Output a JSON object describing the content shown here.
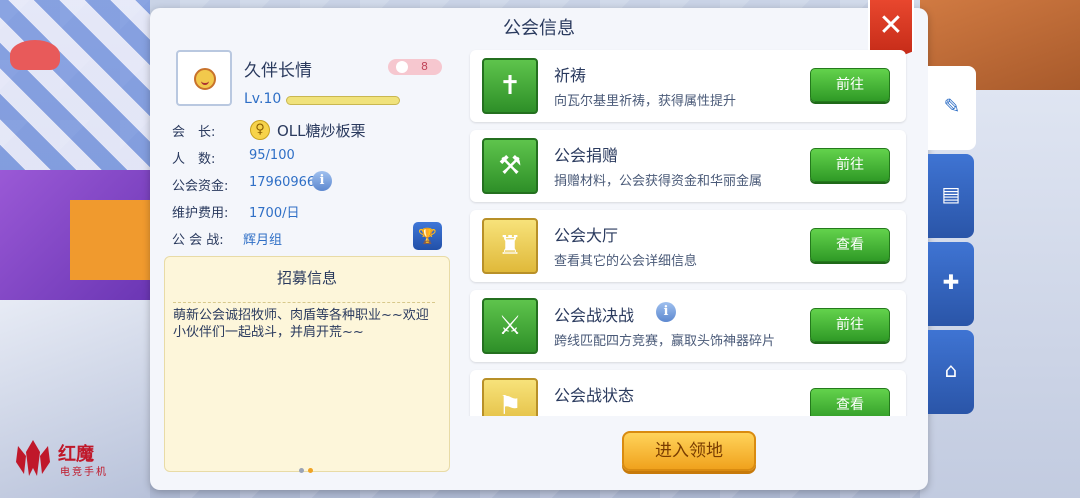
{
  "header": {
    "title": "公会信息",
    "close_icon": "✕"
  },
  "guild": {
    "name": "久伴长情",
    "rank": "8",
    "level": "Lv.10",
    "level_progress": 1.0,
    "rows": [
      {
        "label": "会　长:",
        "value": "OLL糖炒板栗"
      },
      {
        "label": "人　数:",
        "value": "95/100"
      },
      {
        "label": "公会资金:",
        "value": "17960966"
      },
      {
        "label": "维护费用:",
        "value": "1700/日"
      },
      {
        "label": "公 会 战:",
        "value": "辉月组"
      }
    ]
  },
  "recruit": {
    "title": "招募信息",
    "text": "萌新公会诚招牧师、肉盾等各种职业~~欢迎小伙伴们一起战斗，并肩开荒~~"
  },
  "cards": [
    {
      "title": "祈祷",
      "desc": "向瓦尔基里祈祷，获得属性提升",
      "button": "前往",
      "icon": "prayer-icon"
    },
    {
      "title": "公会捐赠",
      "desc": "捐赠材料，公会获得资金和华丽金属",
      "button": "前往",
      "icon": "donate-icon"
    },
    {
      "title": "公会大厅",
      "desc": "查看其它的公会详细信息",
      "button": "查看",
      "icon": "castle-icon"
    },
    {
      "title": "公会战决战",
      "desc": "跨线匹配四方竞赛，赢取头饰神器碎片",
      "button": "前往",
      "icon": "battle-icon"
    },
    {
      "title": "公会战状态",
      "desc": "",
      "button": "查看",
      "icon": "flag-castle-icon"
    }
  ],
  "enter_button": "进入领地",
  "watermark": {
    "brand": "红魔",
    "sub": "电竞手机"
  },
  "colors": {
    "accent": "#2f6fc6",
    "green_button": "#2f9a26",
    "orange_button": "#f0a21d",
    "close": "#c42a17"
  }
}
